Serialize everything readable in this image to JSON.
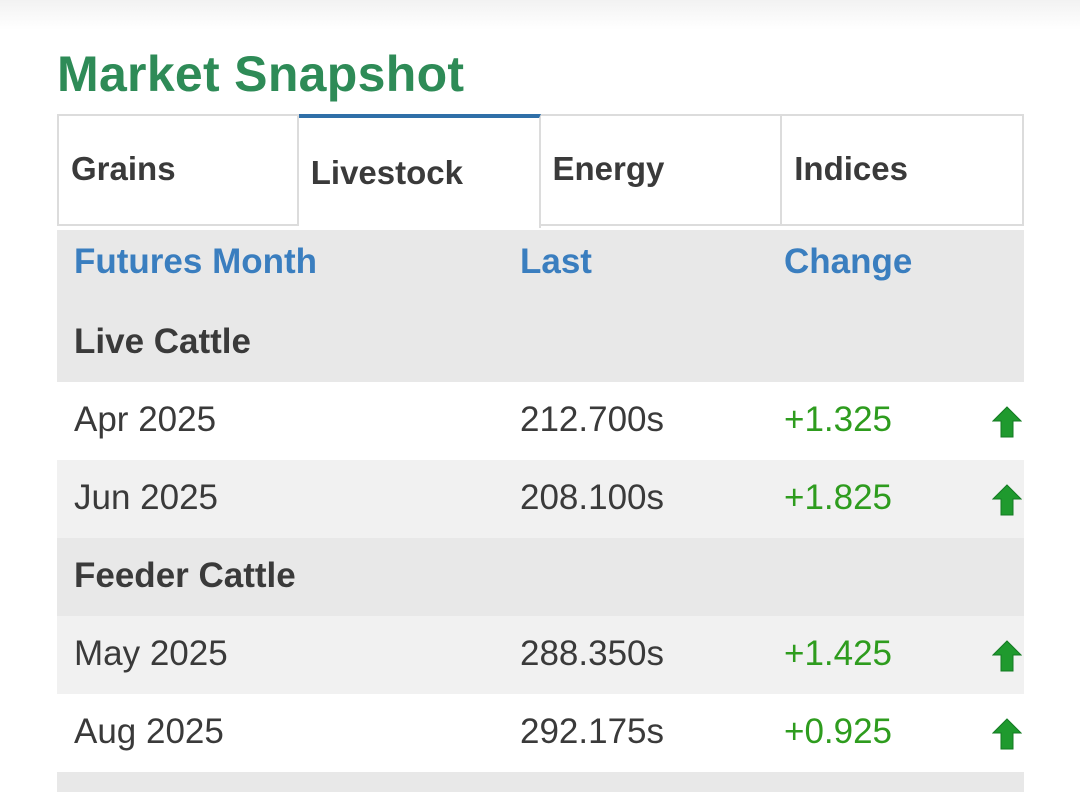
{
  "title": "Market Snapshot",
  "tabs": [
    {
      "label": "Grains",
      "active": false
    },
    {
      "label": "Livestock",
      "active": true
    },
    {
      "label": "Energy",
      "active": false
    },
    {
      "label": "Indices",
      "active": false
    }
  ],
  "table": {
    "headers": {
      "month": "Futures Month",
      "last": "Last",
      "change": "Change"
    },
    "groups": [
      {
        "name": "Live Cattle",
        "rows": [
          {
            "month": "Apr 2025",
            "last": "212.700s",
            "change": "+1.325",
            "direction": "up-arrow-icon"
          },
          {
            "month": "Jun 2025",
            "last": "208.100s",
            "change": "+1.825",
            "direction": "up-arrow-icon"
          }
        ]
      },
      {
        "name": "Feeder Cattle",
        "rows": [
          {
            "month": "May 2025",
            "last": "288.350s",
            "change": "+1.425",
            "direction": "up-arrow-icon"
          },
          {
            "month": "Aug 2025",
            "last": "292.175s",
            "change": "+0.925",
            "direction": "up-arrow-icon"
          }
        ]
      }
    ]
  },
  "colors": {
    "title": "#2e8b57",
    "header_text": "#3a7ebf",
    "active_tab_border": "#2f6fa8",
    "positive_change": "#2e9c1e",
    "arrow": "#1f9a2e"
  }
}
